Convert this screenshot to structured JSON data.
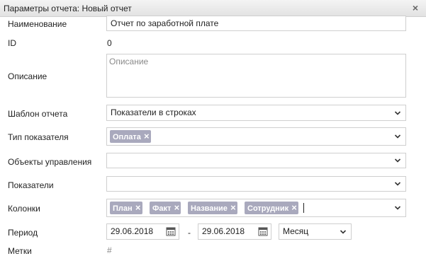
{
  "dialog": {
    "title": "Параметры отчета: Новый отчет"
  },
  "fields": {
    "name": {
      "label": "Наименование",
      "value": "Отчет по заработной плате"
    },
    "id": {
      "label": "ID",
      "value": "0"
    },
    "description": {
      "label": "Описание",
      "placeholder": "Описание"
    },
    "template": {
      "label": "Шаблон отчета",
      "value": "Показатели в строках"
    },
    "indicator_type": {
      "label": "Тип показателя",
      "tags": [
        "Оплата"
      ]
    },
    "control_objects": {
      "label": "Объекты управления",
      "value": ""
    },
    "indicators": {
      "label": "Показатели",
      "value": ""
    },
    "columns": {
      "label": "Колонки",
      "tags": [
        "План",
        "Факт",
        "Название",
        "Сотрудник"
      ]
    },
    "period": {
      "label": "Период",
      "from": "29.06.2018",
      "separator": "-",
      "to": "29.06.2018",
      "granularity": "Месяц"
    },
    "tags_field": {
      "label": "Метки",
      "value": "#"
    }
  },
  "icons": {
    "close": "×",
    "tag_remove": "×"
  }
}
